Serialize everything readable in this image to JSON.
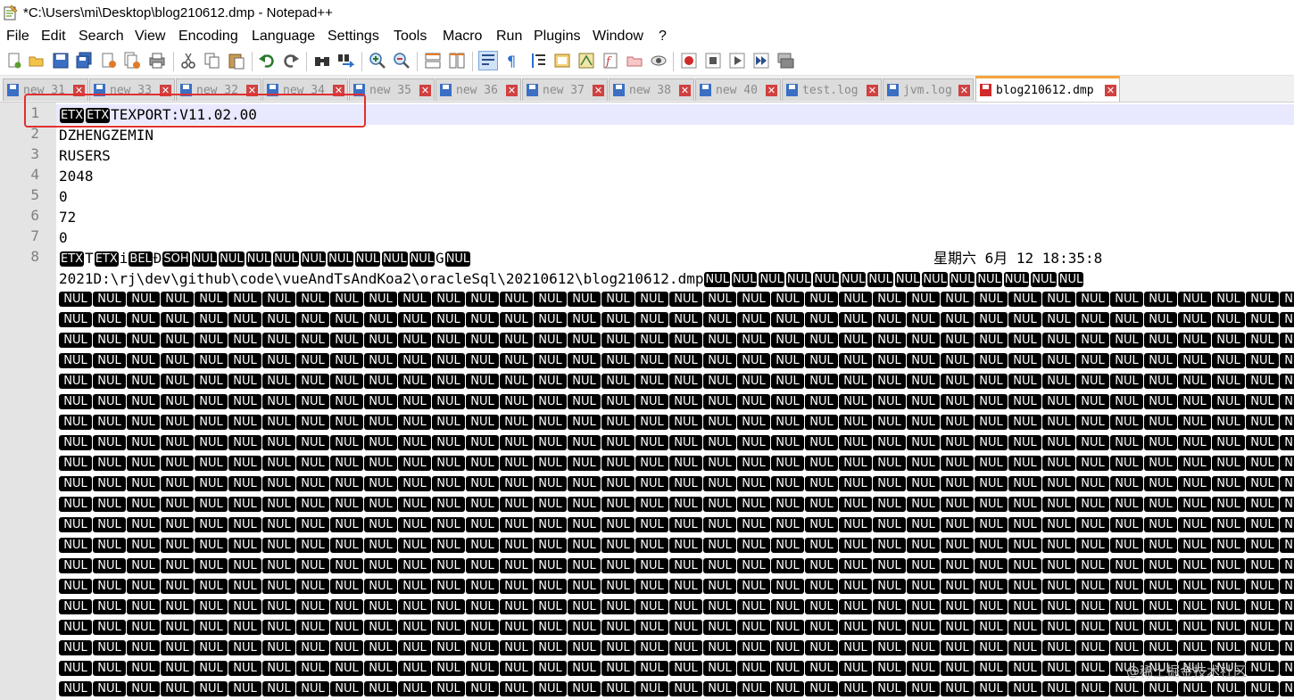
{
  "window": {
    "title": "*C:\\Users\\mi\\Desktop\\blog210612.dmp - Notepad++"
  },
  "menu": [
    "File",
    "Edit",
    "Search",
    "View",
    "Encoding",
    "Language",
    "Settings",
    "Tools",
    "Macro",
    "Run",
    "Plugins",
    "Window",
    "?"
  ],
  "toolbar_icons": [
    "new-file-icon",
    "open-file-icon",
    "save-icon",
    "save-all-icon",
    "close-icon",
    "close-all-icon",
    "print-icon",
    "cut-icon",
    "copy-icon",
    "paste-icon",
    "undo-icon",
    "redo-icon",
    "find-icon",
    "replace-icon",
    "zoom-in-icon",
    "zoom-out-icon",
    "sync-vertical-icon",
    "sync-horizontal-icon",
    "word-wrap-icon",
    "show-all-characters-icon",
    "indent-guide-icon",
    "udl-icon",
    "document-map-icon",
    "function-list-icon",
    "folder-workspace-icon",
    "monitoring-icon",
    "record-macro-icon",
    "stop-recording-icon",
    "playback-icon",
    "run-macro-multiple-icon",
    "save-macro-icon"
  ],
  "tabs": [
    {
      "label": "new 31",
      "active": false
    },
    {
      "label": "new 33",
      "active": false
    },
    {
      "label": "new 32",
      "active": false
    },
    {
      "label": "new 34",
      "active": false
    },
    {
      "label": "new 35",
      "active": false
    },
    {
      "label": "new 36",
      "active": false
    },
    {
      "label": "new 37",
      "active": false
    },
    {
      "label": "new 38",
      "active": false
    },
    {
      "label": "new 40",
      "active": false
    },
    {
      "label": "test.log",
      "active": false
    },
    {
      "label": "jvm.log",
      "active": false
    },
    {
      "label": "blog210612.dmp",
      "active": true
    }
  ],
  "editor": {
    "line_numbers": [
      "1",
      "2",
      "3",
      "4",
      "5",
      "6",
      "7",
      "8"
    ],
    "line1": {
      "cc1": "ETX",
      "cc2": "ETX",
      "text": "TEXPORT:V11.02.00"
    },
    "line2": "DZHENGZEMIN",
    "line3": "RUSERS",
    "line4": "2048",
    "line5": "0",
    "line6": "72",
    "line7": "0",
    "line8": {
      "cc_etx1": "ETX",
      "t1": "T",
      "cc_etx2": "ETX",
      "t2": "i",
      "cc_bel": "BEL",
      "t3": "Đ",
      "cc_soh": "SOH",
      "cc_nul": "NUL",
      "t4": "G",
      "cc_nul_end": "NUL",
      "date": "星期六 6月 12 18:35:8"
    },
    "line8_wrap": {
      "text": "2021D:\\rj\\dev\\github\\code\\vueAndTsAndKoa2\\oracleSql\\20210612\\blog210612.dmp",
      "cc": "NUL"
    },
    "nul_label": "NUL",
    "nul_row_count": 20
  },
  "watermark": "@稀土掘金技术社区",
  "accent_colors": {
    "active_tab": "#f5a43c",
    "annotation": "#e03030",
    "current_line": "#e8e8ff"
  }
}
